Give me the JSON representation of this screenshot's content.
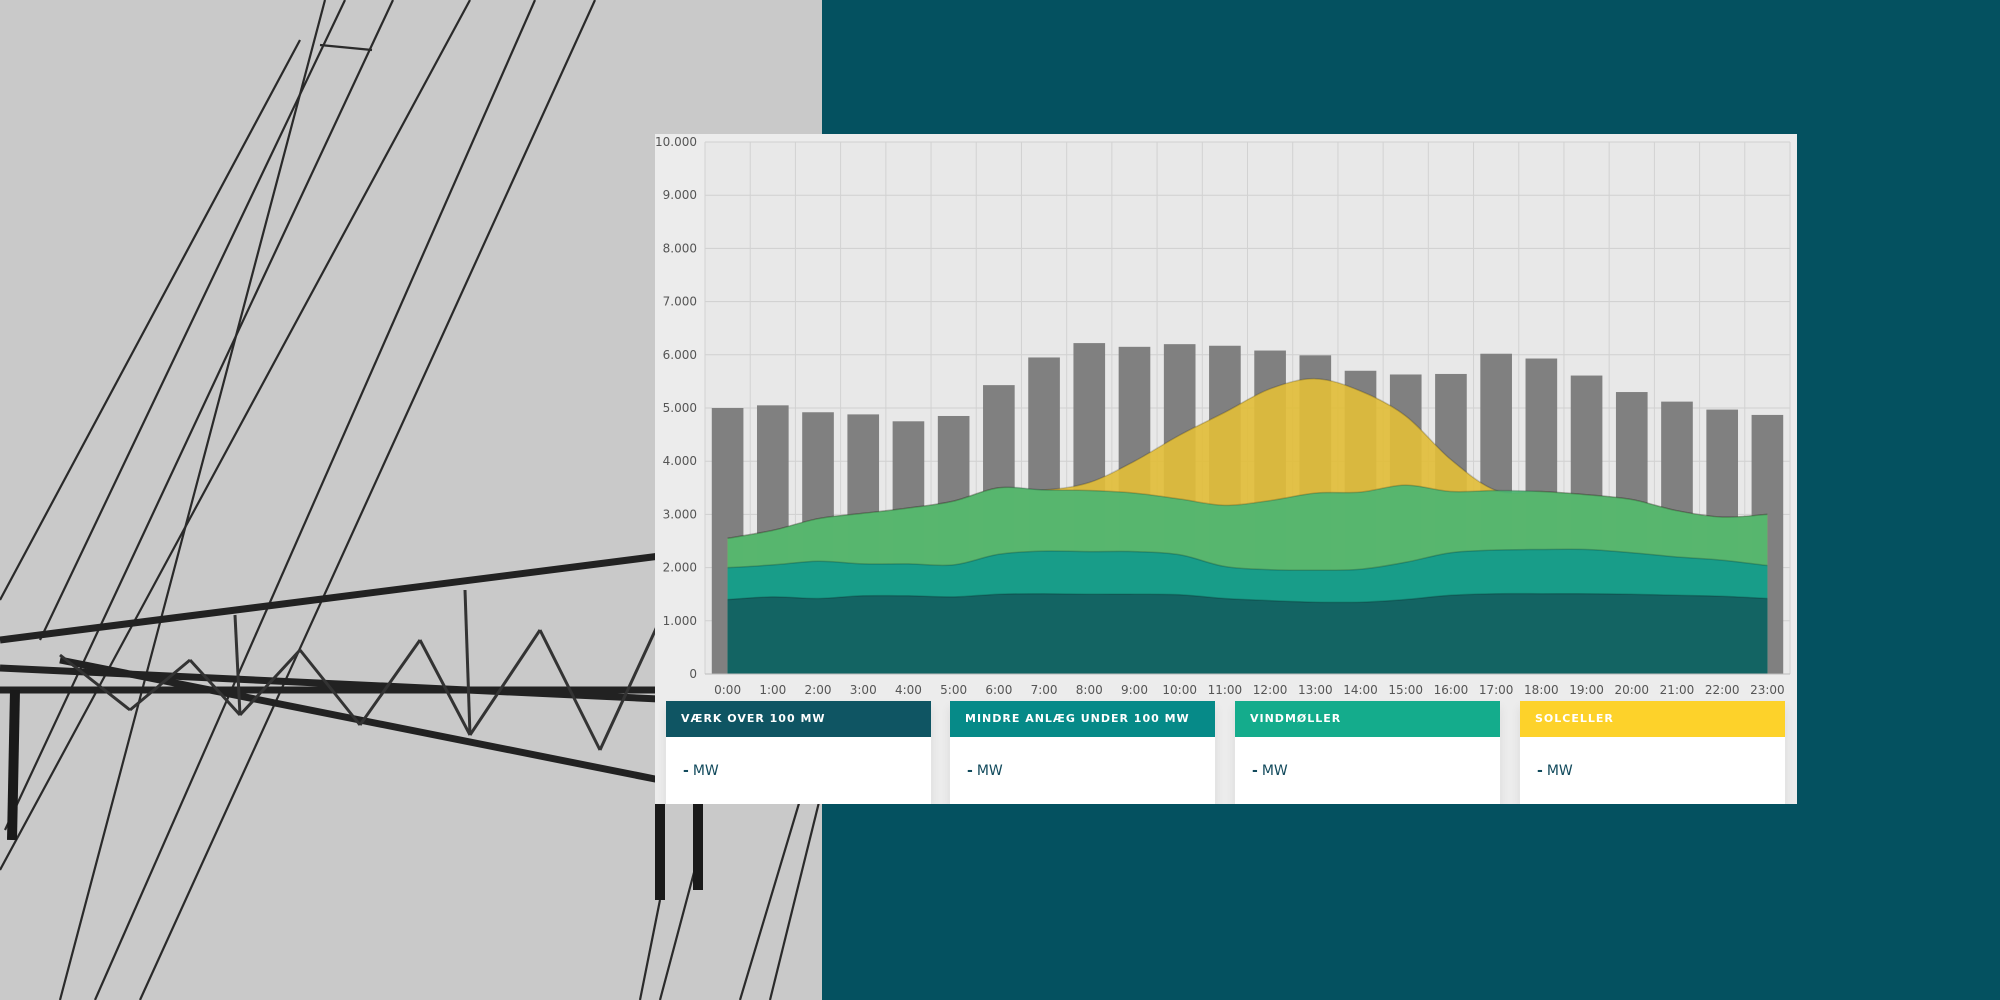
{
  "colors": {
    "background": "#045160",
    "photo": "#c9c9c9",
    "chart_bg": "#ececec",
    "bars": "#808080",
    "large_plants": "#13605f",
    "small_plants": "#129b8b",
    "wind": "#4cb572",
    "solar": "#e1bd39"
  },
  "legend": [
    {
      "label": "VÆRK OVER 100 MW",
      "value": "-",
      "unit": "MW",
      "color": "#0f5563"
    },
    {
      "label": "MINDRE ANLÆG UNDER 100 MW",
      "value": "-",
      "unit": "MW",
      "color": "#068a88"
    },
    {
      "label": "VINDMØLLER",
      "value": "-",
      "unit": "MW",
      "color": "#14ac8c"
    },
    {
      "label": "SOLCELLER",
      "value": "-",
      "unit": "MW",
      "color": "#fdd22a"
    }
  ],
  "chart_data": {
    "type": "bar",
    "title": "",
    "xlabel": "",
    "ylabel": "",
    "ylim": [
      0,
      10000
    ],
    "y_ticks": [
      "0",
      "1.000",
      "2.000",
      "3.000",
      "4.000",
      "5.000",
      "6.000",
      "7.000",
      "8.000",
      "9.000",
      "10.000"
    ],
    "categories": [
      "0:00",
      "1:00",
      "2:00",
      "3:00",
      "4:00",
      "5:00",
      "6:00",
      "7:00",
      "8:00",
      "9:00",
      "10:00",
      "11:00",
      "12:00",
      "13:00",
      "14:00",
      "15:00",
      "16:00",
      "17:00",
      "18:00",
      "19:00",
      "20:00",
      "21:00",
      "22:00",
      "23:00"
    ],
    "grid": true,
    "bars": [
      5000,
      5050,
      4920,
      4880,
      4750,
      4850,
      5430,
      5950,
      6220,
      6150,
      6200,
      6170,
      6080,
      5990,
      5700,
      5630,
      5640,
      6020,
      5930,
      5610,
      5300,
      5120,
      4970,
      4870
    ],
    "stacked_areas": [
      {
        "key": "large",
        "values": [
          1400,
          1450,
          1420,
          1470,
          1470,
          1450,
          1500,
          1510,
          1500,
          1500,
          1490,
          1420,
          1380,
          1350,
          1350,
          1400,
          1480,
          1510,
          1510,
          1510,
          1500,
          1480,
          1460,
          1420
        ]
      },
      {
        "key": "small",
        "values": [
          600,
          600,
          700,
          600,
          600,
          600,
          750,
          800,
          800,
          800,
          750,
          600,
          580,
          600,
          620,
          700,
          800,
          820,
          830,
          830,
          780,
          720,
          680,
          620
        ]
      },
      {
        "key": "wind",
        "values": [
          550,
          650,
          800,
          950,
          1050,
          1200,
          1250,
          1150,
          1150,
          1100,
          1050,
          1150,
          1300,
          1450,
          1450,
          1450,
          1150,
          1120,
          1090,
          1030,
          1000,
          870,
          810,
          960
        ]
      },
      {
        "key": "solar",
        "values": [
          0,
          0,
          0,
          0,
          0,
          0,
          0,
          0,
          150,
          600,
          1200,
          1750,
          2100,
          2150,
          1900,
          1300,
          600,
          0,
          0,
          0,
          0,
          0,
          0,
          0
        ]
      }
    ]
  }
}
